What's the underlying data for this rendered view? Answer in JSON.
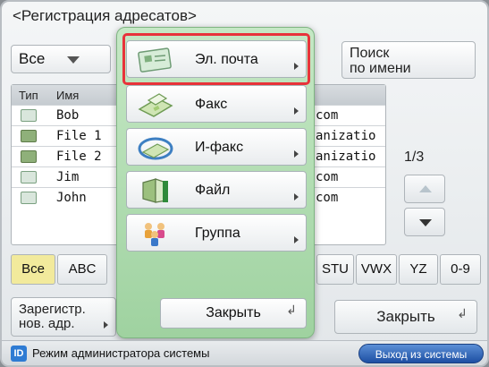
{
  "window": {
    "title": "<Регистрация адресатов>"
  },
  "filter": {
    "selected": "Все"
  },
  "search_button": {
    "line1": "Поиск",
    "line2": "по имени"
  },
  "list": {
    "headers": {
      "type": "Тип",
      "name": "Имя"
    },
    "rows": [
      {
        "icon": "mail-icon",
        "name": "Bob",
        "tail": "com"
      },
      {
        "icon": "file-icon",
        "name": "File 1",
        "tail": "anizatio"
      },
      {
        "icon": "file-icon",
        "name": "File 2",
        "tail": "anizatio"
      },
      {
        "icon": "mail-icon",
        "name": "Jim",
        "tail": "com"
      },
      {
        "icon": "mail-icon",
        "name": "John",
        "tail": "com"
      }
    ]
  },
  "pagination": {
    "indicator": "1/3"
  },
  "alpha_tabs": [
    "Все",
    "ABC",
    "STU",
    "VWX",
    "YZ",
    "0-9"
  ],
  "alpha_selected": "Все",
  "register_button": {
    "line1": "Зарегистр.",
    "line2": "нов. адр."
  },
  "close_button": "Закрыть",
  "status": {
    "badge": "ID",
    "text": "Режим администратора системы",
    "logout": "Выход из системы"
  },
  "menu": {
    "items": [
      {
        "label": "Эл. почта",
        "icon": "email-icon"
      },
      {
        "label": "Факс",
        "icon": "fax-icon"
      },
      {
        "label": "И-факс",
        "icon": "ifax-icon"
      },
      {
        "label": "Файл",
        "icon": "file-icon"
      },
      {
        "label": "Группа",
        "icon": "group-icon"
      }
    ],
    "selected": "Эл. почта",
    "close": "Закрыть"
  },
  "colors": {
    "modal_bg": "#b3ddb4",
    "selection_frame": "#e8333a",
    "active_tab": "#f2ea9c",
    "logout_button": "#1d4fa3"
  }
}
